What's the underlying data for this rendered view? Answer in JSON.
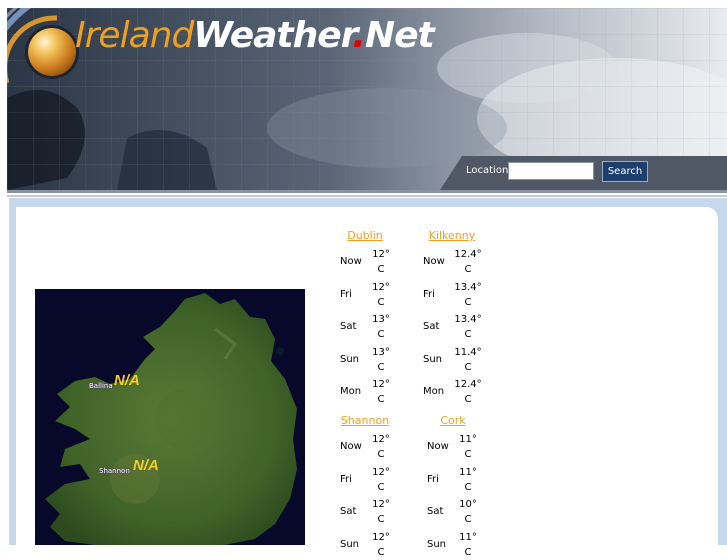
{
  "header": {
    "logo_part1": "Ireland",
    "logo_part2": "Weather",
    "logo_dot": ".",
    "logo_part3": "Net",
    "location_label": "Location",
    "location_value": "",
    "search_label": "Search"
  },
  "map": {
    "labels": [
      {
        "place": "Ballina",
        "value": "N/A"
      },
      {
        "place": "Shannon",
        "value": "N/A"
      }
    ]
  },
  "cities": [
    {
      "name": "Dublin",
      "rows": [
        {
          "day": "Now",
          "temp": "12°",
          "unit": "C"
        },
        {
          "day": "Fri",
          "temp": "12°",
          "unit": "C"
        },
        {
          "day": "Sat",
          "temp": "13°",
          "unit": "C"
        },
        {
          "day": "Sun",
          "temp": "13°",
          "unit": "C"
        },
        {
          "day": "Mon",
          "temp": "12°",
          "unit": "C"
        }
      ]
    },
    {
      "name": "Kilkenny",
      "rows": [
        {
          "day": "Now",
          "temp": "12.4°",
          "unit": "C"
        },
        {
          "day": "Fri",
          "temp": "13.4°",
          "unit": "C"
        },
        {
          "day": "Sat",
          "temp": "13.4°",
          "unit": "C"
        },
        {
          "day": "Sun",
          "temp": "11.4°",
          "unit": "C"
        },
        {
          "day": "Mon",
          "temp": "12.4°",
          "unit": "C"
        }
      ]
    },
    {
      "name": "Shannon",
      "rows": [
        {
          "day": "Now",
          "temp": "12°",
          "unit": "C"
        },
        {
          "day": "Fri",
          "temp": "12°",
          "unit": "C"
        },
        {
          "day": "Sat",
          "temp": "12°",
          "unit": "C"
        },
        {
          "day": "Sun",
          "temp": "12°",
          "unit": "C"
        }
      ]
    },
    {
      "name": "Cork",
      "rows": [
        {
          "day": "Now",
          "temp": "11°",
          "unit": "C"
        },
        {
          "day": "Fri",
          "temp": "11°",
          "unit": "C"
        },
        {
          "day": "Sat",
          "temp": "10°",
          "unit": "C"
        },
        {
          "day": "Sun",
          "temp": "11°",
          "unit": "C"
        }
      ]
    }
  ],
  "colors": {
    "accent": "#f0a020",
    "search_button": "#1e3e6e",
    "frame": "#c8d8ec"
  }
}
